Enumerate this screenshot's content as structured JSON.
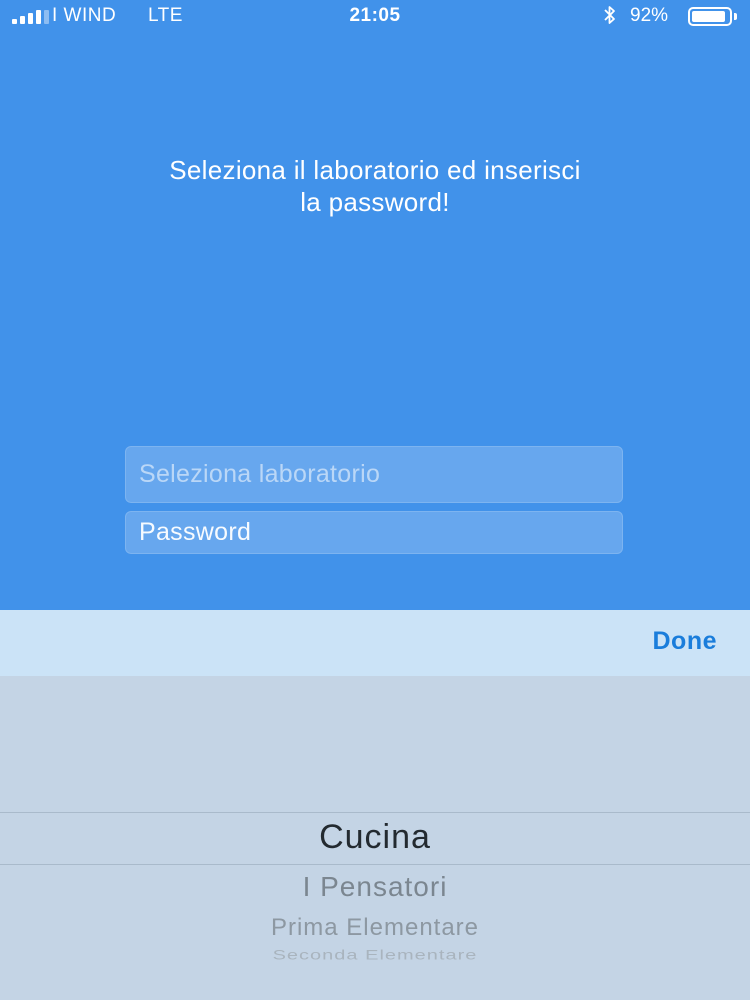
{
  "status_bar": {
    "carrier": "I WIND",
    "network": "LTE",
    "time": "21:05",
    "battery_percent": "92%",
    "battery_level": 0.92,
    "signal_bars": 4,
    "icons": [
      "signal-icon",
      "bluetooth-icon",
      "battery-icon"
    ]
  },
  "main": {
    "headline_line1": "Seleziona il laboratorio ed inserisci",
    "headline_line2": "la password!",
    "lab_field_placeholder": "Seleziona laboratorio",
    "password_field_placeholder": "Password"
  },
  "toolbar": {
    "done_label": "Done"
  },
  "picker": {
    "selected": "Cucina",
    "options_below": [
      "I Pensatori",
      "Prima Elementare",
      "Seconda Elementare"
    ]
  },
  "colors": {
    "background": "#4192ea",
    "toolbar": "#cbe3f7",
    "picker": "#c4d4e5",
    "accent": "#1a7ddb"
  }
}
